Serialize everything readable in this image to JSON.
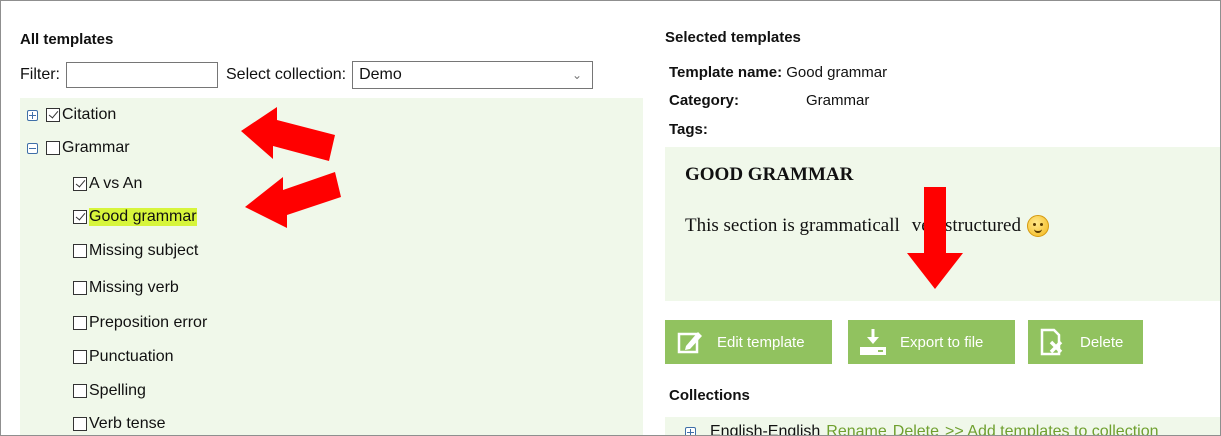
{
  "left_panel": {
    "title": "All templates",
    "filter_label": "Filter:",
    "filter_value": "",
    "collection_label": "Select collection:",
    "collection_value": "Demo",
    "tree": [
      {
        "label": "Citation",
        "expanded": false,
        "checked": true
      },
      {
        "label": "Grammar",
        "expanded": true,
        "checked": false,
        "children": [
          {
            "label": "A vs An",
            "checked": true
          },
          {
            "label": "Good grammar",
            "checked": true,
            "highlighted": true
          },
          {
            "label": "Missing subject",
            "checked": false
          },
          {
            "label": "Missing verb",
            "checked": false
          },
          {
            "label": "Preposition error",
            "checked": false
          },
          {
            "label": "Punctuation",
            "checked": false
          },
          {
            "label": "Spelling",
            "checked": false
          },
          {
            "label": "Verb tense",
            "checked": false
          }
        ]
      }
    ]
  },
  "right_panel": {
    "title": "Selected templates",
    "name_label": "Template name:",
    "name_value": "Good grammar",
    "category_label": "Category:",
    "category_value": "Grammar",
    "tags_label": "Tags:",
    "preview_title": "GOOD GRAMMAR",
    "preview_body_a": "This section is grammaticall",
    "preview_body_b": "vell structured",
    "buttons": {
      "edit": "Edit template",
      "export": "Export to file",
      "delete": "Delete"
    },
    "collections_title": "Collections",
    "collection_row": {
      "name": "English-English",
      "rename": "Rename",
      "delete": "Delete",
      "add": ">> Add templates to collection"
    }
  },
  "colors": {
    "button_green": "#91c25f",
    "panel_bg": "#f0f8ea",
    "highlight": "#d7f53b",
    "arrow_red": "#ff0000",
    "link_green": "#6fa02f"
  }
}
